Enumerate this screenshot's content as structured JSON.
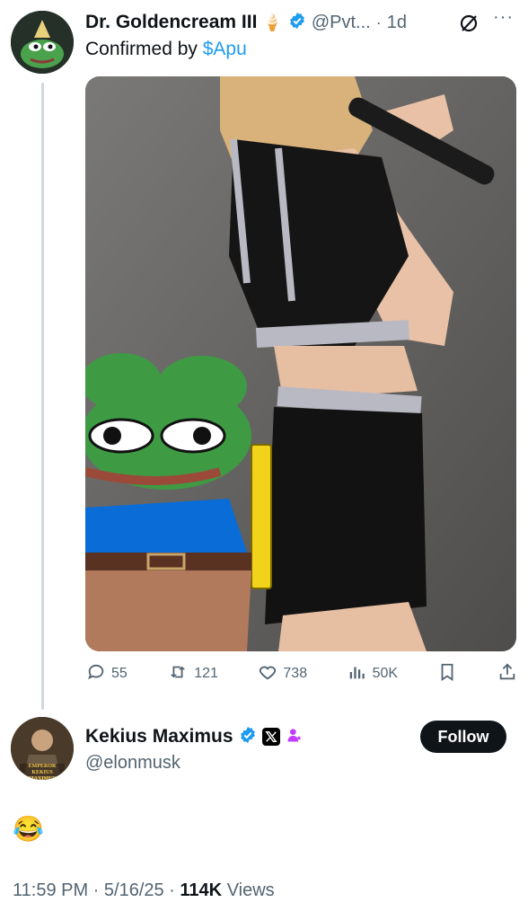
{
  "tweet": {
    "author_name": "Dr. Goldencream III",
    "handle": "@Pvt...",
    "time": "1d",
    "text_prefix": "Confirmed by",
    "cashtag": "$Apu",
    "badge_emoji": "🍦",
    "stats": {
      "replies": "55",
      "reposts": "121",
      "likes": "738",
      "views": "50K"
    }
  },
  "reply": {
    "author_name": "Kekius Maximus",
    "handle": "@elonmusk",
    "follow_label": "Follow",
    "avatar_text": "EMPEROR KEKIUS MAXIMUS",
    "content_emoji": "😂",
    "timestamp": "11:59 PM · 5/16/25 ·",
    "views_count": "114K",
    "views_label": "Views"
  },
  "colors": {
    "accent": "#1d9bf0",
    "muted": "#536471",
    "pepe_green": "#3e9b44",
    "pepe_shirt": "#0a6cd6"
  }
}
